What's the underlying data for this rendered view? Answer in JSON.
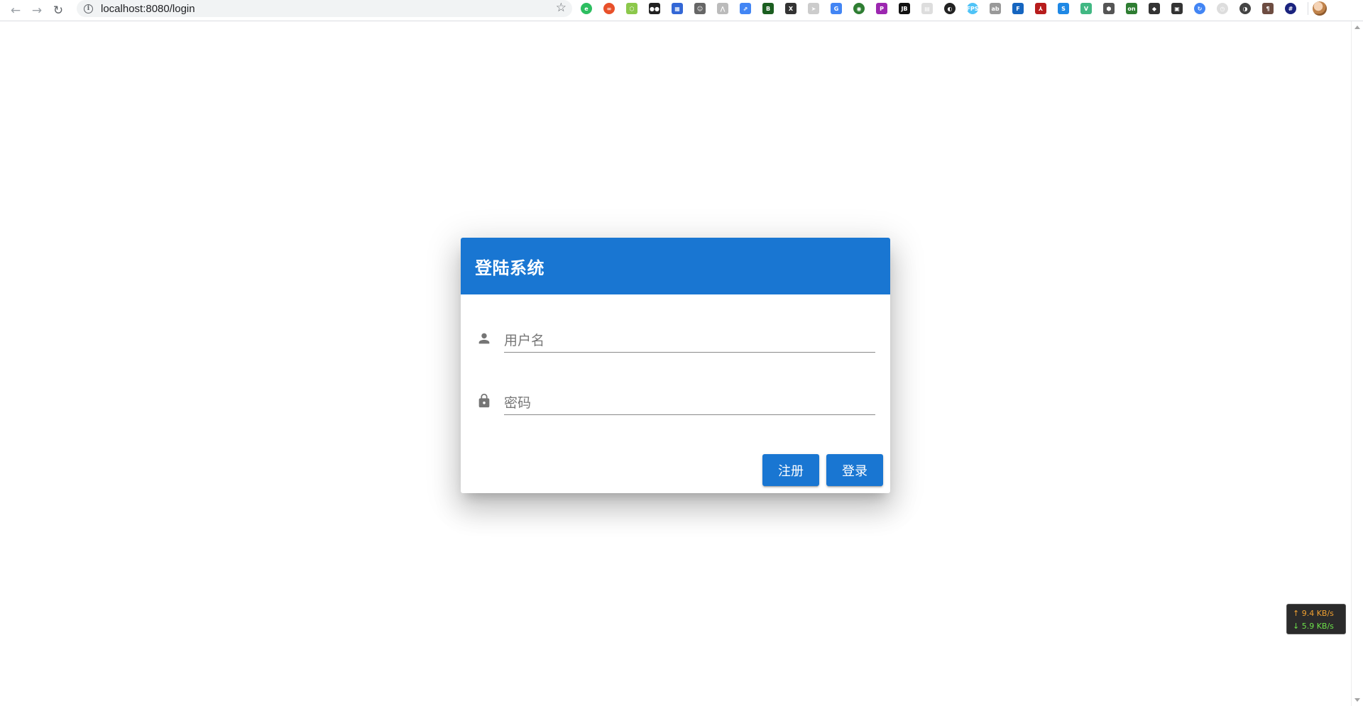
{
  "browser": {
    "url": "localhost:8080/login",
    "extensions": [
      {
        "name": "evernote-icon",
        "color": "#2dbe60",
        "glyph": "e",
        "round": true
      },
      {
        "name": "infinity-icon",
        "color": "#e8502a",
        "glyph": "∞",
        "round": true
      },
      {
        "name": "nodejs-icon",
        "color": "#8cc84b",
        "glyph": "⬡",
        "round": false
      },
      {
        "name": "glasses-icon",
        "color": "#222222",
        "glyph": "●●",
        "round": false
      },
      {
        "name": "calendar-icon",
        "color": "#3367d6",
        "glyph": "▦",
        "round": false
      },
      {
        "name": "cat-icon",
        "color": "#666666",
        "glyph": "☺",
        "round": false
      },
      {
        "name": "wave-icon",
        "color": "#bbbbbb",
        "glyph": "⋀",
        "round": false
      },
      {
        "name": "share-icon",
        "color": "#4285f4",
        "glyph": "⇗",
        "round": false
      },
      {
        "name": "b-icon",
        "color": "#1b5e20",
        "glyph": "B",
        "round": false
      },
      {
        "name": "x-icon",
        "color": "#333333",
        "glyph": "X",
        "round": false
      },
      {
        "name": "send-icon",
        "color": "#cccccc",
        "glyph": "➤",
        "round": false
      },
      {
        "name": "translate-icon",
        "color": "#4285f4",
        "glyph": "G",
        "round": false
      },
      {
        "name": "globe-icon",
        "color": "#2e7d32",
        "glyph": "◉",
        "round": true
      },
      {
        "name": "jp-icon",
        "color": "#9c27b0",
        "glyph": "P",
        "round": false
      },
      {
        "name": "jb-icon",
        "color": "#111111",
        "glyph": "JB",
        "round": false
      },
      {
        "name": "page-icon",
        "color": "#dddddd",
        "glyph": "▤",
        "round": false
      },
      {
        "name": "github-icon",
        "color": "#222222",
        "glyph": "◐",
        "round": true
      },
      {
        "name": "fps-icon",
        "color": "#4fc3f7",
        "glyph": "FPS",
        "round": true
      },
      {
        "name": "ab-icon",
        "color": "#999999",
        "glyph": "ab",
        "round": false
      },
      {
        "name": "f-icon",
        "color": "#1565c0",
        "glyph": "F",
        "round": false
      },
      {
        "name": "pdf-icon",
        "color": "#b71c1c",
        "glyph": "⅄",
        "round": false
      },
      {
        "name": "s-icon",
        "color": "#1e88e5",
        "glyph": "S",
        "round": false
      },
      {
        "name": "vue-icon",
        "color": "#41b883",
        "glyph": "V",
        "round": false
      },
      {
        "name": "hex-icon",
        "color": "#555555",
        "glyph": "⬢",
        "round": false
      },
      {
        "name": "list-on-icon",
        "color": "#2e7d32",
        "glyph": "on",
        "round": false
      },
      {
        "name": "cube-icon",
        "color": "#333333",
        "glyph": "◆",
        "round": false
      },
      {
        "name": "screen-icon",
        "color": "#333333",
        "glyph": "▣",
        "round": false
      },
      {
        "name": "refresh-check-icon",
        "color": "#4285f4",
        "glyph": "↻",
        "round": true
      },
      {
        "name": "clock-icon",
        "color": "#dddddd",
        "glyph": "◷",
        "round": true
      },
      {
        "name": "moon-icon",
        "color": "#444444",
        "glyph": "◑",
        "round": true
      },
      {
        "name": "pilcrow-icon",
        "color": "#6d4c41",
        "glyph": "¶",
        "round": false
      },
      {
        "name": "hash-icon",
        "color": "#1a237e",
        "glyph": "#",
        "round": true
      }
    ]
  },
  "login": {
    "title": "登陆系统",
    "username_placeholder": "用户名",
    "password_placeholder": "密码",
    "register_label": "注册",
    "login_label": "登录"
  },
  "netspeed": {
    "upload": "↑ 9.4 KB/s",
    "download": "↓ 5.9 KB/s"
  },
  "colors": {
    "primary": "#1976d2"
  }
}
